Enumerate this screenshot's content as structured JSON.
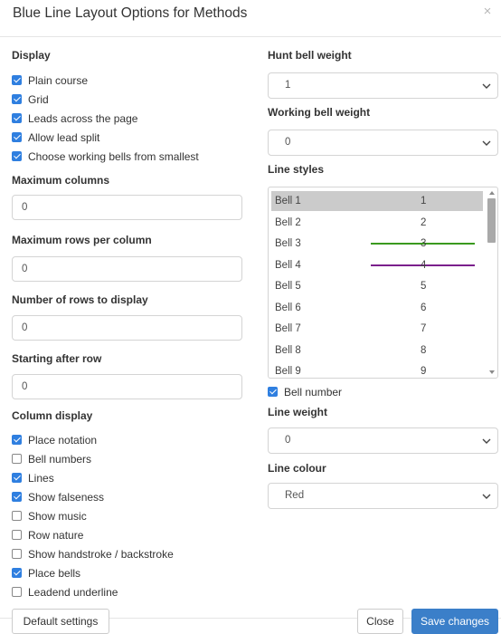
{
  "modal": {
    "title": "Blue Line Layout Options for Methods",
    "close_symbol": "×"
  },
  "display": {
    "title": "Display",
    "options": [
      {
        "label": "Plain course",
        "checked": true
      },
      {
        "label": "Grid",
        "checked": true
      },
      {
        "label": "Leads across the page",
        "checked": true
      },
      {
        "label": "Allow lead split",
        "checked": true
      },
      {
        "label": "Choose working bells from smallest",
        "checked": true
      }
    ]
  },
  "fields": {
    "max_columns": {
      "label": "Maximum columns",
      "value": "0"
    },
    "max_rows": {
      "label": "Maximum rows per column",
      "value": "0"
    },
    "num_rows": {
      "label": "Number of rows to display",
      "value": "0"
    },
    "start_row": {
      "label": "Starting after row",
      "value": "0"
    }
  },
  "column_display": {
    "title": "Column display",
    "options": [
      {
        "label": "Place notation",
        "checked": true
      },
      {
        "label": "Bell numbers",
        "checked": false
      },
      {
        "label": "Lines",
        "checked": true
      },
      {
        "label": "Show falseness",
        "checked": true
      },
      {
        "label": "Show music",
        "checked": false
      },
      {
        "label": "Row nature",
        "checked": false
      },
      {
        "label": "Show handstroke / backstroke",
        "checked": false
      },
      {
        "label": "Place bells",
        "checked": true
      },
      {
        "label": "Leadend underline",
        "checked": false
      }
    ]
  },
  "hunt_bell_weight": {
    "label": "Hunt bell weight",
    "value": "1"
  },
  "working_bell_weight": {
    "label": "Working bell weight",
    "value": "0"
  },
  "line_styles": {
    "label": "Line styles",
    "bells": [
      {
        "name": "Bell 1",
        "number": "1",
        "line_color": "",
        "selected": true
      },
      {
        "name": "Bell 2",
        "number": "2",
        "line_color": "",
        "selected": false
      },
      {
        "name": "Bell 3",
        "number": "3",
        "line_color": "#3a9a1e",
        "selected": false
      },
      {
        "name": "Bell 4",
        "number": "4",
        "line_color": "#7b1f8c",
        "selected": false
      },
      {
        "name": "Bell 5",
        "number": "5",
        "line_color": "",
        "selected": false
      },
      {
        "name": "Bell 6",
        "number": "6",
        "line_color": "",
        "selected": false
      },
      {
        "name": "Bell 7",
        "number": "7",
        "line_color": "",
        "selected": false
      },
      {
        "name": "Bell 8",
        "number": "8",
        "line_color": "",
        "selected": false
      },
      {
        "name": "Bell 9",
        "number": "9",
        "line_color": "",
        "selected": false
      }
    ]
  },
  "bell_number": {
    "label": "Bell number",
    "checked": true
  },
  "line_weight": {
    "label": "Line weight",
    "value": "0"
  },
  "line_colour": {
    "label": "Line colour",
    "value": "Red"
  },
  "footer": {
    "default_label": "Default settings",
    "close_label": "Close",
    "save_label": "Save changes"
  },
  "colors": {
    "accent": "#2f7fe0",
    "primary_button": "#3b7fc9",
    "selected_row": "#cbcbcb"
  }
}
